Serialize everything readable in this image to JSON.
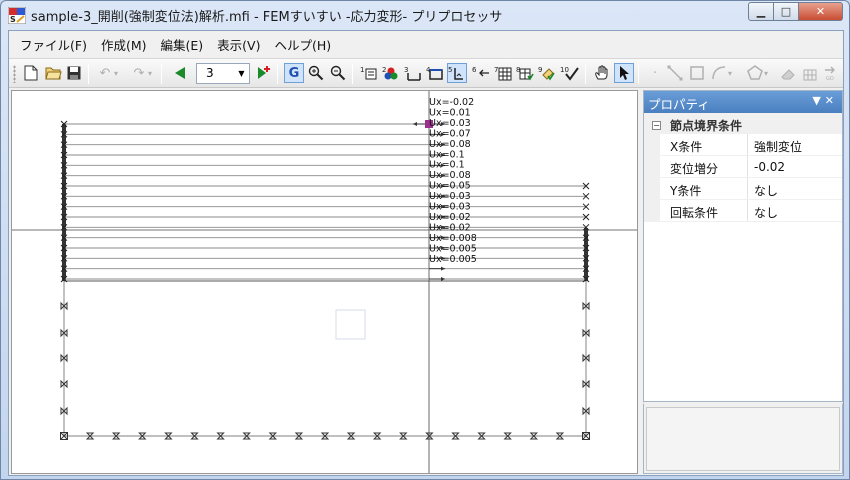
{
  "window": {
    "title": "sample-3_開削(強制変位法)解析.mfi - FEMすいすい -応力変形- プリプロセッサ",
    "minimize_symbol": "▁",
    "maximize_symbol": "□",
    "close_symbol": "✕"
  },
  "menu": [
    {
      "label": "ファイル(F)"
    },
    {
      "label": "作成(M)"
    },
    {
      "label": "編集(E)"
    },
    {
      "label": "表示(V)"
    },
    {
      "label": "ヘルプ(H)"
    }
  ],
  "toolbar": {
    "step_value": "3",
    "icons": {
      "new": "new-file-icon",
      "open": "open-folder-icon",
      "save": "save-icon",
      "undo": "undo-icon",
      "redo": "redo-icon",
      "prev": "previous-step-icon",
      "add": "add-step-icon",
      "grid": "grid-snap-icon",
      "zoom_in": "zoom-in-icon",
      "zoom_out": "zoom-out-icon",
      "pan": "hand-pan-icon",
      "select": "select-arrow-icon"
    }
  },
  "canvas": {
    "labels": [
      "Ux=-0.02",
      "Ux=0.01",
      "Ux=0.03",
      "Ux=0.07",
      "Ux=0.08",
      "Ux=0.1",
      "Ux=0.1",
      "Ux=0.08",
      "Ux=0.05",
      "Ux=0.03",
      "Ux=0.03",
      "Ux=0.02",
      "Ux=0.02",
      "Ux=0.008",
      "Ux=0.005",
      "Ux=0.005"
    ]
  },
  "properties": {
    "title": "プロパティ",
    "category": "節点境界条件",
    "rows": [
      {
        "name": "X条件",
        "value": "強制変位"
      },
      {
        "name": "変位増分",
        "value": "-0.02"
      },
      {
        "name": "Y条件",
        "value": "なし"
      },
      {
        "name": "回転条件",
        "value": "なし"
      }
    ]
  },
  "colors": {
    "selected_node": "#9b2f8c",
    "panel_header": "#5b8fcd",
    "play_green": "#1a8a2a"
  }
}
